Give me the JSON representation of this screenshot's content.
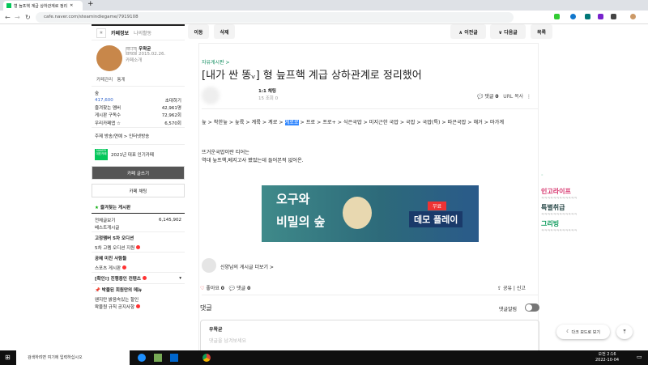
{
  "browser": {
    "tab_title": "형 늪프핵 계급 상하관계로 정리",
    "url": "cafe.naver.com/steamindiegame/7919108"
  },
  "sidebar": {
    "tabs": [
      "카페정보",
      "나의활동"
    ],
    "manager_badge": "매니저",
    "manager_name": "우왁굳",
    "since": "since 2015.02.26.",
    "intro": "카페소개",
    "admin": "카페관리",
    "stats": "통계",
    "grade": "숲",
    "members": "417,600",
    "invite": "초대하기",
    "info_rows": [
      {
        "label": "즐겨찾는 멤버",
        "value": "42,961명"
      },
      {
        "label": "게시판 구독수",
        "value": "72,962회"
      },
      {
        "label": "우리카페앱 ☆",
        "value": "6,570회"
      }
    ],
    "topic": "주제 방송/연예 > 인터넷방송",
    "naver_badge": "NAVER 대표카페",
    "award": "2021년 대표 인기카페",
    "write_button": "카페 글쓰기",
    "chat_button": "카페 채팅",
    "fav_boards": "즐겨찾는 게시판",
    "boards": [
      {
        "label": "전체글보기",
        "count": "6,145,902"
      },
      {
        "label": "베스트게시글"
      },
      {
        "label": "고정멤버 5차 오디션",
        "header": true
      },
      {
        "label": "5차 고멤 오디션 지원",
        "new": true
      },
      {
        "label": "공혜 미친 사람들",
        "header": true
      },
      {
        "label": "스포츠 게시판",
        "new": true
      },
      {
        "label": "[확인!] 진행중인 컨텐츠",
        "header": true,
        "new": true
      },
      {
        "label": "박물된 회원만의 메뉴",
        "header": true
      },
      {
        "label": "왠지만 밝음속있는 할인"
      },
      {
        "label": "왁물원 규칙 공지사항",
        "new": true
      }
    ]
  },
  "toolbar": {
    "move": "이동",
    "delete": "삭제",
    "prev": "∧ 이전글",
    "next": "∨ 다음글",
    "list": "목록"
  },
  "article": {
    "board": "자유게시판 >",
    "title": "[내가 싼 똥ᵥ] 형 늪프핵 계급 상하관계로 정리했어",
    "chat": "1:1 채팅",
    "meta": "15 조회 0",
    "comments_label": "댓글",
    "comments_count": "0",
    "url_copy": "URL 복사",
    "tier_before": "늪 > 착한늪 > 늪륙 > 계륙 > 계로 > ",
    "tier_highlight": "계로로",
    "tier_after": " > 프로 > 프로+ > 식은국밥 > 미지근한 국밥 > 국밥 > 국밥(특) > 따끈국밥 > 해거 > 마가계",
    "body1": "뜨거운국밥이란 티어는",
    "body2": "역대 늪프핵,베지고사 봤었는데 들어본적 없어온.",
    "banner": {
      "left1": "오구와",
      "left2": "비밀의 숲",
      "tag": "무료",
      "right": "데모 플레이"
    },
    "author_more": "신양남의 게시글 더보기 >",
    "like": "좋아요",
    "like_count": "0",
    "comment": "댓글",
    "comment_count": "0",
    "share": "공유",
    "report": "신고",
    "comment_title": "댓글",
    "comment_alarm": "댓글알림",
    "comment_user": "우왁굳",
    "comment_placeholder": "댓글을 남겨보세요"
  },
  "right_panel": {
    "items": [
      {
        "name": "인고라이프",
        "color": "#d6336c"
      },
      {
        "name": "특별취급",
        "color": "#2b4a4a"
      },
      {
        "name": "그리빙",
        "color": "#0a9a5a"
      }
    ],
    "sub": "ㅋㅋㅋㅋㅋㅋㅋㅋㅋㅋㅋㅋ",
    "dark_mode": "다크 모드로 보기"
  },
  "taskbar": {
    "search": "검색하려면 여기에 입력하십시오",
    "time": "오전 2:16",
    "date": "2022-10-04"
  }
}
